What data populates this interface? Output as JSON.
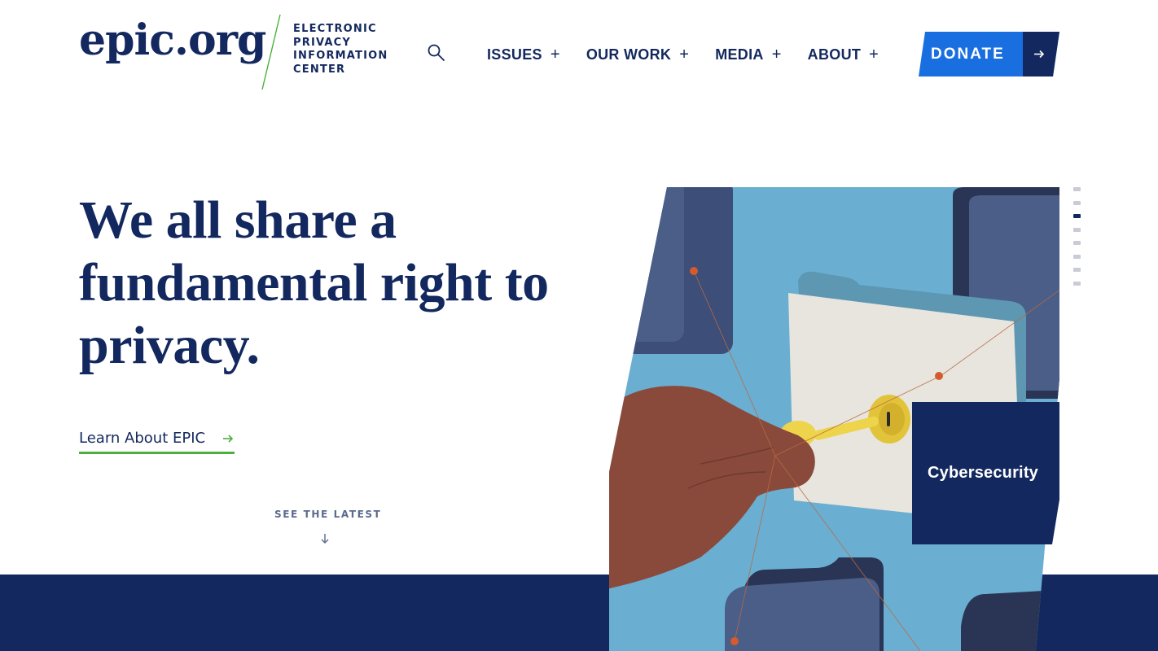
{
  "header": {
    "logo": "epic.org",
    "logo_subtitle": [
      "ELECTRONIC",
      "PRIVACY",
      "INFORMATION",
      "CENTER"
    ],
    "nav": [
      {
        "label": "ISSUES",
        "expand": "+"
      },
      {
        "label": "OUR WORK",
        "expand": "+"
      },
      {
        "label": "MEDIA",
        "expand": "+"
      },
      {
        "label": "ABOUT",
        "expand": "+"
      }
    ],
    "donate_label": "DONATE",
    "search_icon": "search-icon"
  },
  "hero": {
    "title": "We all share a fundamental right to privacy.",
    "link_label": "Learn About EPIC",
    "see_latest": "SEE THE LATEST"
  },
  "slide": {
    "badge_label": "Cybersecurity",
    "active_index": 2,
    "count": 8
  },
  "colors": {
    "navy": "#13285e",
    "blue": "#1a6fe0",
    "green": "#4caf3f",
    "sky": "#6aafd1"
  }
}
